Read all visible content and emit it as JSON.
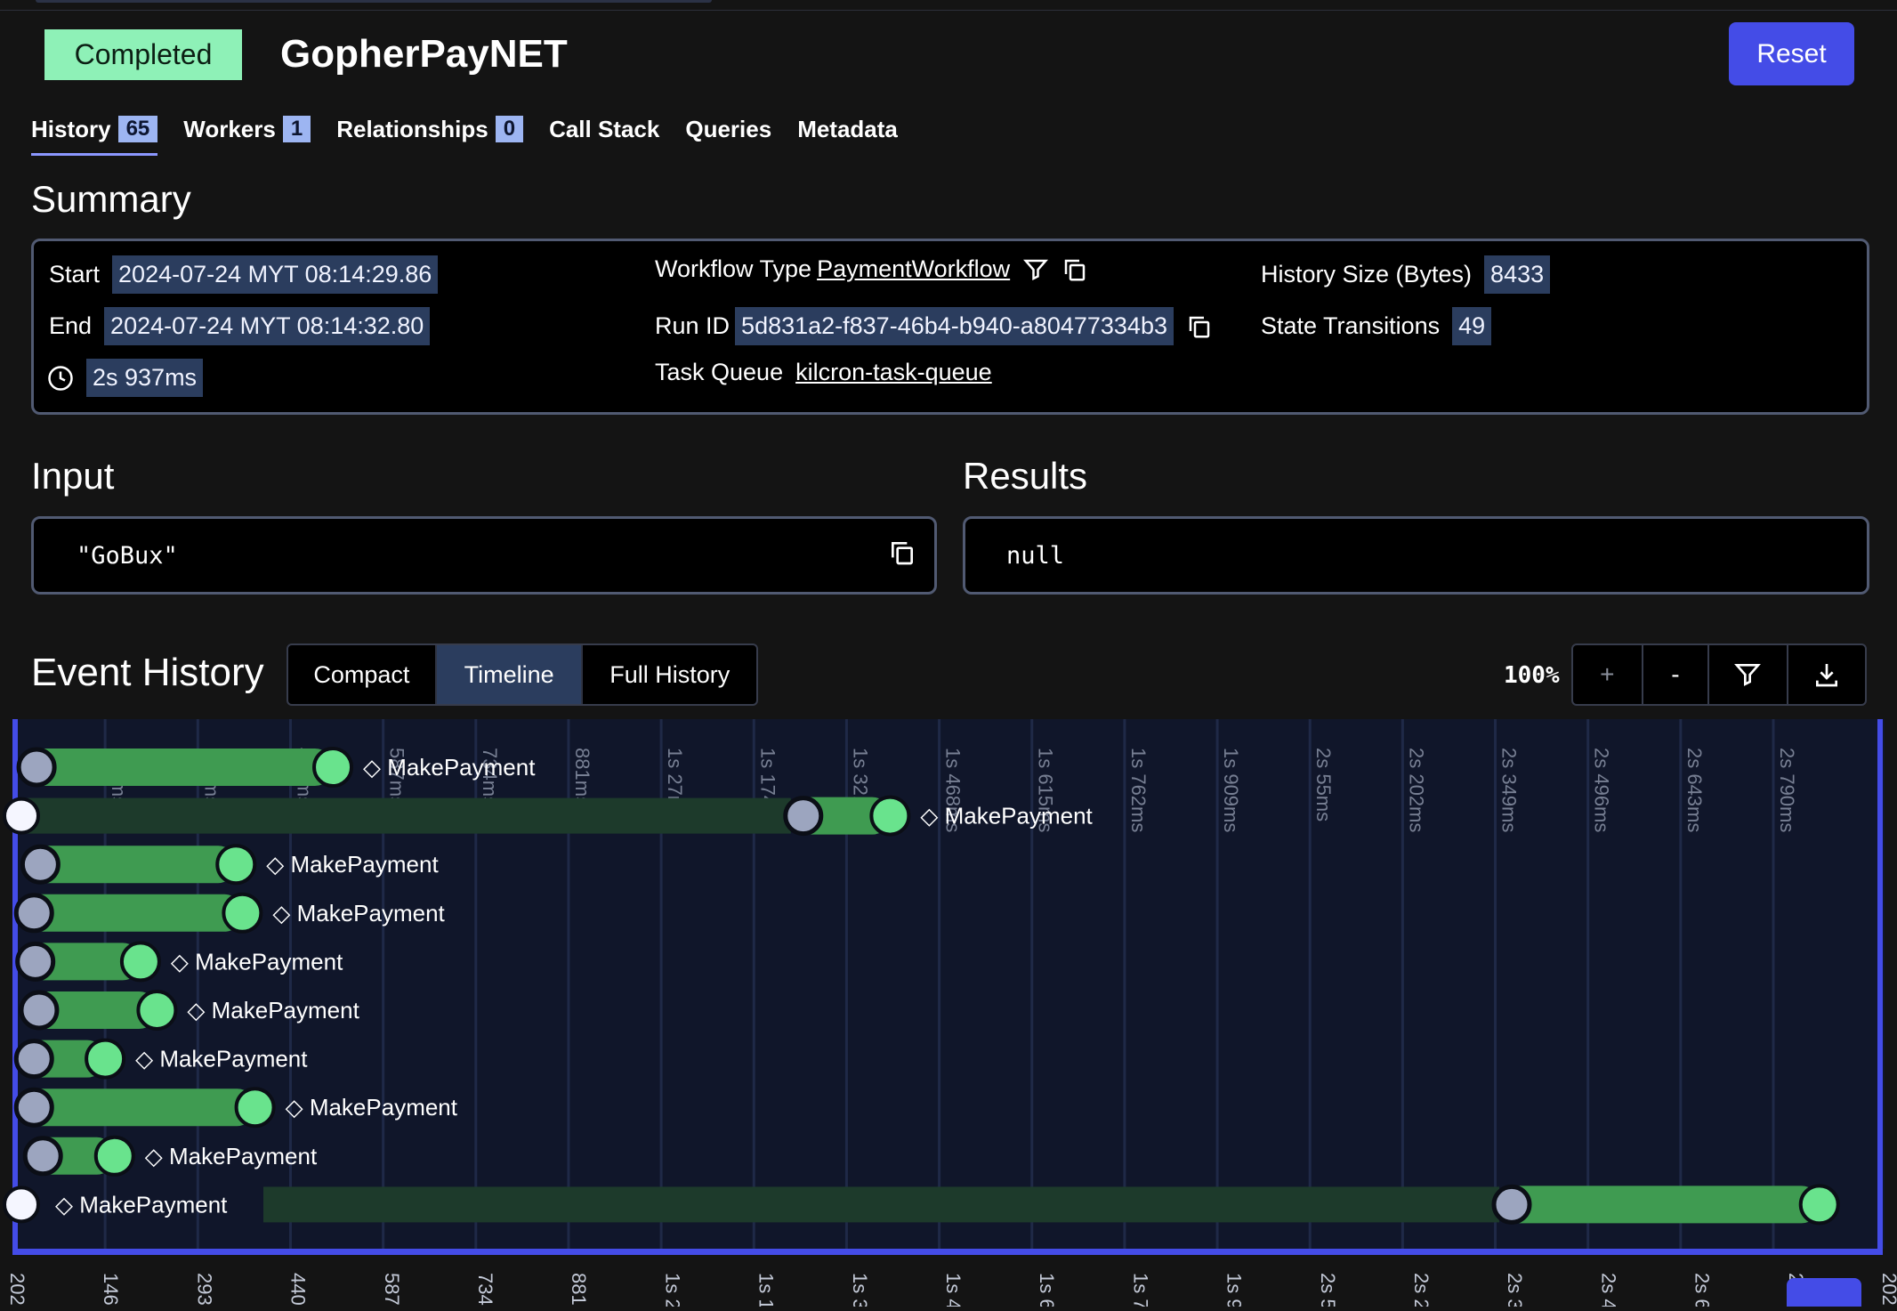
{
  "header": {
    "status": "Completed",
    "title": "GopherPayNET",
    "reset_label": "Reset"
  },
  "tabs": [
    {
      "label": "History",
      "count": "65"
    },
    {
      "label": "Workers",
      "count": "1"
    },
    {
      "label": "Relationships",
      "count": "0"
    },
    {
      "label": "Call Stack"
    },
    {
      "label": "Queries"
    },
    {
      "label": "Metadata"
    }
  ],
  "summary": {
    "heading": "Summary",
    "start_label": "Start",
    "start_value": "2024-07-24 MYT 08:14:29.86",
    "end_label": "End",
    "end_value": "2024-07-24 MYT 08:14:32.80",
    "duration": "2s 937ms",
    "workflow_type_label": "Workflow Type",
    "workflow_type": "PaymentWorkflow",
    "run_id_label": "Run ID",
    "run_id": "5d831a2-f837-46b4-b940-a80477334b3",
    "task_queue_label": "Task Queue",
    "task_queue": "kilcron-task-queue",
    "history_size_label": "History Size (Bytes)",
    "history_size": "8433",
    "state_transitions_label": "State Transitions",
    "state_transitions": "49"
  },
  "input": {
    "heading": "Input",
    "value": "\"GoBux\""
  },
  "results": {
    "heading": "Results",
    "value": "null"
  },
  "event_history": {
    "heading": "Event History",
    "views": [
      "Compact",
      "Timeline",
      "Full History"
    ],
    "active_view": "Timeline",
    "zoom": "100%",
    "zoom_in": "+",
    "zoom_out": "-"
  },
  "timeline": {
    "top_ticks": [
      "146ms",
      "293ms",
      "440ms",
      "587ms",
      "734ms",
      "881ms",
      "1s 27ms",
      "1s 174ms",
      "1s 321ms",
      "1s 468ms",
      "1s 615ms",
      "1s 762ms",
      "1s 909ms",
      "2s 55ms",
      "2s 202ms",
      "2s 349ms",
      "2s 496ms",
      "2s 643ms",
      "2s 790ms"
    ],
    "bottom_ticks": [
      "202",
      "146",
      "293",
      "440",
      "587",
      "734",
      "881",
      "1s 2",
      "1s 1",
      "1s 3",
      "1s 4",
      "1s 6",
      "1s 7",
      "1s 9",
      "2s 5",
      "2s 2",
      "2s 3",
      "2s 4",
      "2s 6",
      "2",
      "202"
    ],
    "activities": [
      {
        "label": "MakePayment",
        "start_ms": 0,
        "scheduled_ms": 0,
        "started_ms": 10,
        "completed_ms": 498
      },
      {
        "label": "MakePayment",
        "start_ms": 0,
        "scheduled_ms": 0,
        "started_ms": 1222,
        "completed_ms": 1379
      },
      {
        "label": "MakePayment",
        "start_ms": 0,
        "scheduled_ms": 0,
        "started_ms": 16,
        "completed_ms": 345
      },
      {
        "label": "MakePayment",
        "start_ms": 0,
        "scheduled_ms": 0,
        "started_ms": 6,
        "completed_ms": 355
      },
      {
        "label": "MakePayment",
        "start_ms": 0,
        "scheduled_ms": 0,
        "started_ms": 8,
        "completed_ms": 194
      },
      {
        "label": "MakePayment",
        "start_ms": 0,
        "scheduled_ms": 0,
        "started_ms": 14,
        "completed_ms": 220
      },
      {
        "label": "MakePayment",
        "start_ms": 0,
        "scheduled_ms": 0,
        "started_ms": 6,
        "completed_ms": 138
      },
      {
        "label": "MakePayment",
        "start_ms": 0,
        "scheduled_ms": 0,
        "started_ms": 6,
        "completed_ms": 375
      },
      {
        "label": "MakePayment",
        "start_ms": 0,
        "scheduled_ms": 0,
        "started_ms": 20,
        "completed_ms": 153
      },
      {
        "label": "MakePayment",
        "start_ms": 0,
        "scheduled_ms": 0,
        "started_ms": 2342,
        "completed_ms": 2848
      }
    ],
    "total_ms": 2937,
    "colors": {
      "bg": "#10162a",
      "bar": "#3f9b51",
      "bar_dim": "#1d3a2b",
      "start_dot": "#9ca5bf",
      "end_dot": "#69e38d",
      "sched_dot": "#f5f6ff",
      "accent": "#444ce7"
    }
  }
}
